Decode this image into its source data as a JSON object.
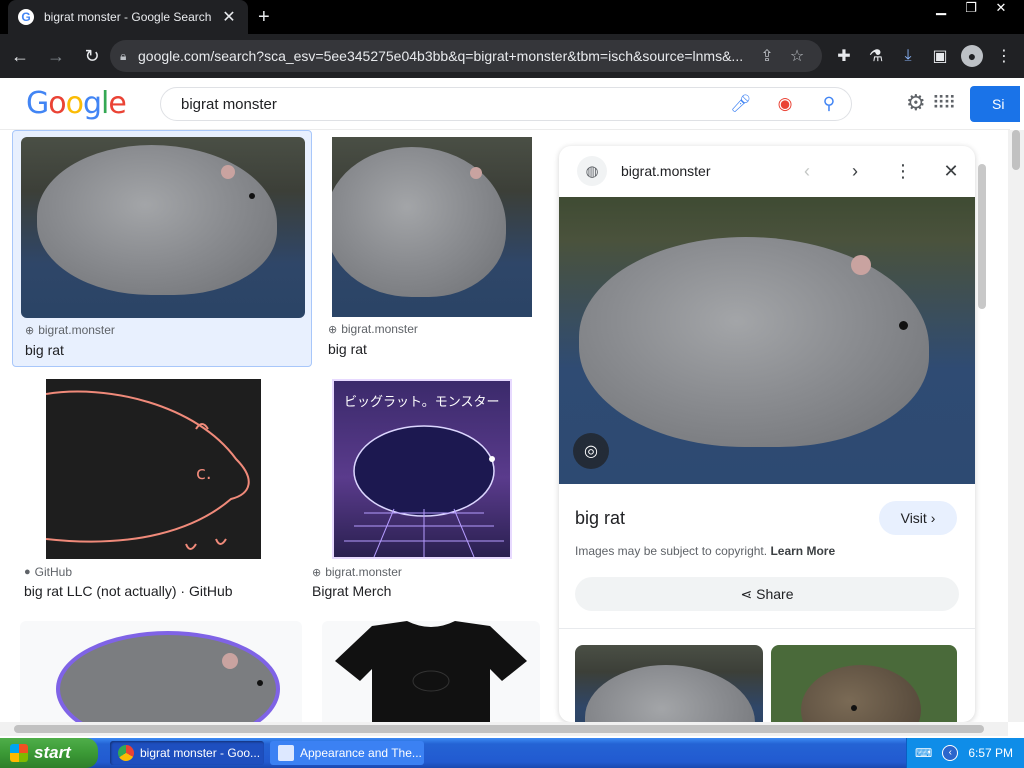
{
  "browser": {
    "tab_title": "bigrat monster - Google Search",
    "url": "google.com/search?sca_esv=5ee345275e04b3bb&q=bigrat+monster&tbm=isch&source=lnms&..."
  },
  "google": {
    "logo": [
      "G",
      "o",
      "o",
      "g",
      "l",
      "e"
    ],
    "logo_colors": [
      "#4285f4",
      "#ea4335",
      "#fbbc05",
      "#4285f4",
      "#34a853",
      "#ea4335"
    ],
    "query": "bigrat monster",
    "signin_label": "Si"
  },
  "results": [
    {
      "source": "bigrat.monster",
      "title": "big rat",
      "source_icon": "globe-icon",
      "selected": true
    },
    {
      "source": "bigrat.monster",
      "title": "big rat",
      "source_icon": "globe-icon",
      "selected": false
    },
    {
      "source": "GitHub",
      "title": "big rat LLC (not actually) · GitHub",
      "source_icon": "github-icon",
      "selected": false
    },
    {
      "source": "bigrat.monster",
      "title": "Bigrat Merch",
      "source_icon": "globe-icon",
      "selected": false
    }
  ],
  "merch_overlay_text": "ビッグラット。モンスター",
  "panel": {
    "site": "bigrat.monster",
    "title": "big rat",
    "visit_label": "Visit",
    "copyright_text": "Images may be subject to copyright.",
    "learn_more": "Learn More",
    "share_label": "Share"
  },
  "taskbar": {
    "start_label": "start",
    "tasks": [
      {
        "label": "bigrat monster - Goo...",
        "active": true
      },
      {
        "label": "Appearance and The...",
        "active": false
      }
    ],
    "clock": "6:57 PM"
  }
}
